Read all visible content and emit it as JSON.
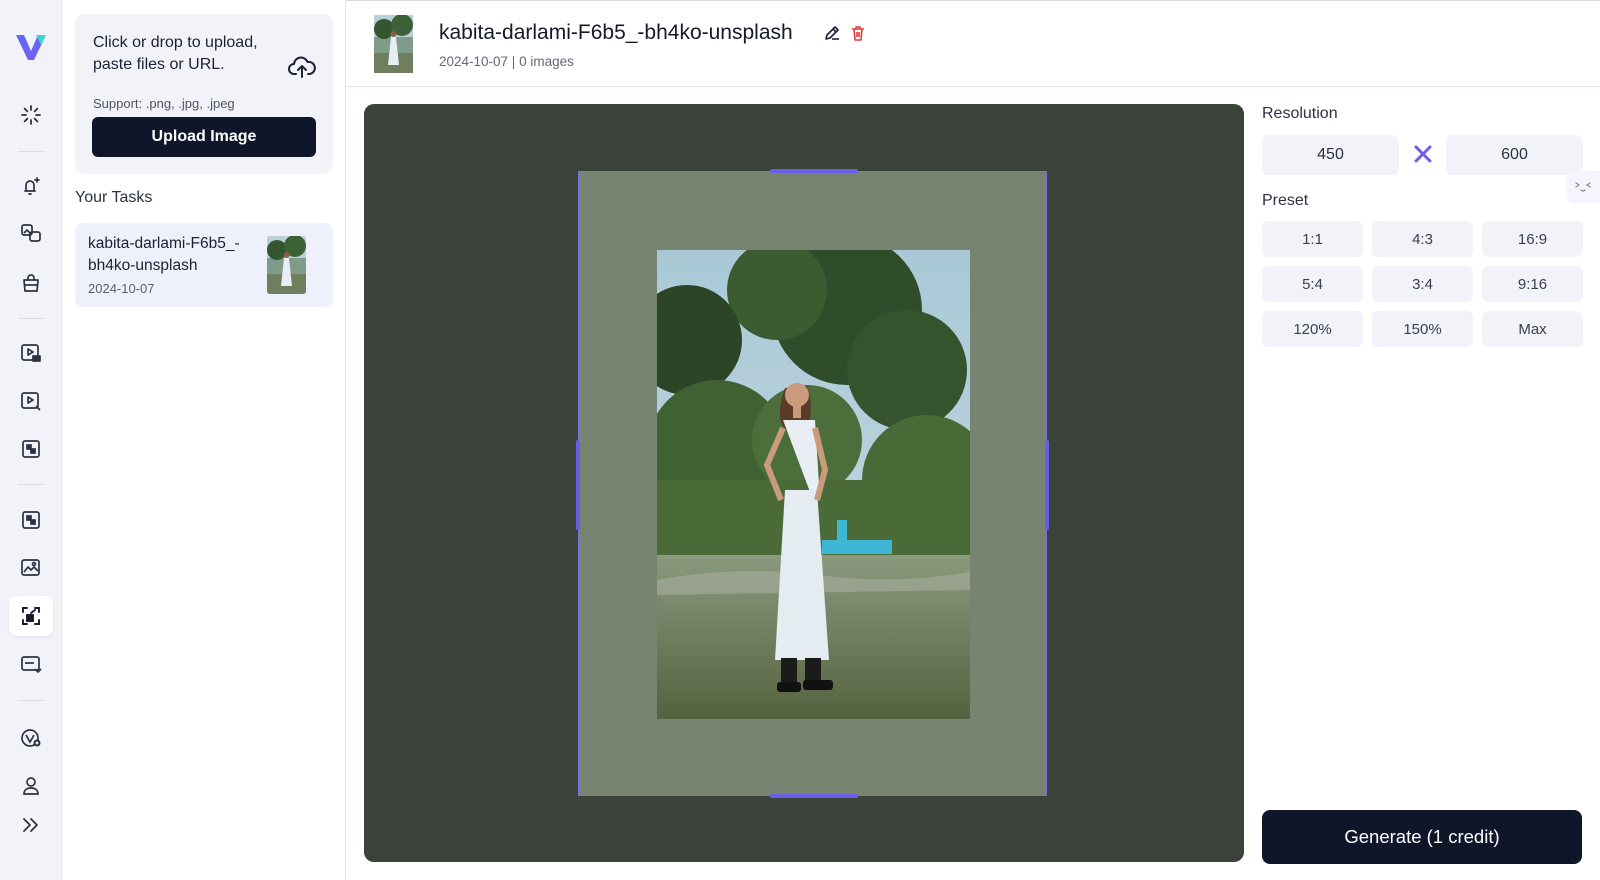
{
  "rail": {
    "items": [
      {
        "icon": "sparkle-loader-icon",
        "active": false
      },
      {
        "icon": "bell-sparkle-icon",
        "active": false
      },
      {
        "icon": "image-swap-icon",
        "active": false
      },
      {
        "icon": "bag-icon",
        "active": false
      },
      {
        "icon": "video-4k-icon",
        "active": false
      },
      {
        "icon": "video-enhance-icon",
        "active": false
      },
      {
        "icon": "video-bg-remove-icon",
        "active": false
      },
      {
        "icon": "image-bg-remove-icon",
        "active": false
      },
      {
        "icon": "image-4k-icon",
        "active": false
      },
      {
        "icon": "image-expand-icon",
        "active": true
      },
      {
        "icon": "watermark-remove-icon",
        "active": false
      },
      {
        "icon": "brand-plus-icon",
        "active": false
      },
      {
        "icon": "user-icon",
        "active": false
      },
      {
        "icon": "expand-sidebar-icon",
        "active": false
      }
    ]
  },
  "upload": {
    "text": "Click or drop to upload, paste files or URL.",
    "support": "Support: .png, .jpg, .jpeg",
    "button": "Upload Image"
  },
  "tasks": {
    "label": "Your Tasks",
    "items": [
      {
        "name": "kabita-darlami-F6b5_-bh4ko-unsplash",
        "date": "2024-10-07"
      }
    ]
  },
  "header": {
    "title": "kabita-darlami-F6b5_-bh4ko-unsplash",
    "meta": "2024-10-07 | 0 images"
  },
  "settings": {
    "resolution_label": "Resolution",
    "width": "450",
    "height": "600",
    "preset_label": "Preset",
    "presets": [
      "1:1",
      "4:3",
      "16:9",
      "5:4",
      "3:4",
      "9:16",
      "120%",
      "150%",
      "Max"
    ]
  },
  "generate_label": "Generate (1 credit)",
  "colors": {
    "accent": "#6a5ee8",
    "dark_button": "#0f1629",
    "canvas_bg": "#3b4239",
    "frame_fill": "#788472",
    "danger": "#e03c3c"
  }
}
